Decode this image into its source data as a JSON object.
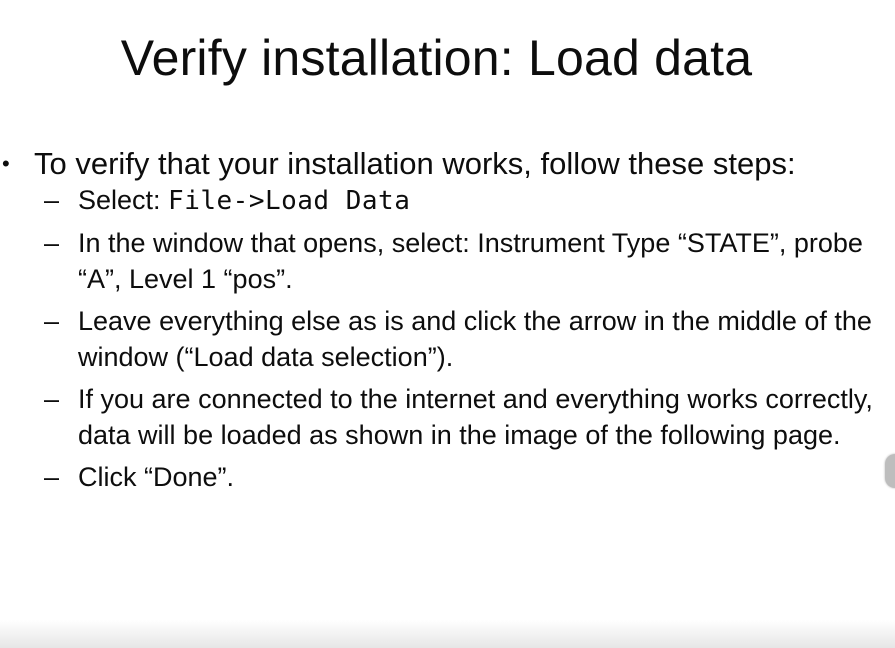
{
  "slide": {
    "title": "Verify installation: Load data",
    "bullet": {
      "marker": "•",
      "text": "To verify that your installation works, follow these steps:"
    },
    "steps": [
      {
        "dash": "–",
        "prefix": "Select: ",
        "code": "File->Load Data"
      },
      {
        "dash": "–",
        "text": "In the window that opens, select: Instrument Type “STATE”, probe “A”, Level 1 “pos”."
      },
      {
        "dash": "–",
        "text": "Leave everything else as is and click the arrow in the middle of the window (“Load data selection”)."
      },
      {
        "dash": "–",
        "text": "If you are connected to the internet and everything works correctly, data will be loaded as shown in the image of the following page."
      },
      {
        "dash": "–",
        "text": "Click “Done”."
      }
    ]
  }
}
